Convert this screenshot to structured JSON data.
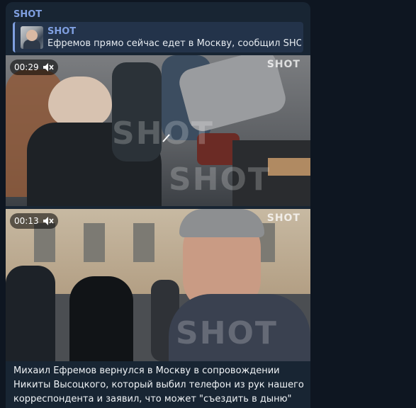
{
  "post": {
    "sender": "SHOT",
    "reply": {
      "name": "SHOT",
      "text": "Ефремов прямо сейчас едет в Москву, сообщил SHOT ..."
    },
    "videos": [
      {
        "duration": "00:29",
        "muted": true,
        "watermark": "SHOT",
        "big_watermark": "SHOT"
      },
      {
        "duration": "00:13",
        "muted": true,
        "watermark": "SHOT",
        "big_watermark": "SHOT"
      }
    ],
    "caption": "Михаил Ефремов вернулся в Москву в сопровождении Никиты Высоцкого, который выбил телефон из рук нашего корреспондента и заявил, что может \"съездить в дыню\""
  },
  "colors": {
    "background": "#0e1621",
    "bubble": "#182533",
    "accent": "#7f9fe0",
    "reply_bg": "#23334a"
  },
  "icons": [
    "mute-icon",
    "play-indicator-icon"
  ]
}
